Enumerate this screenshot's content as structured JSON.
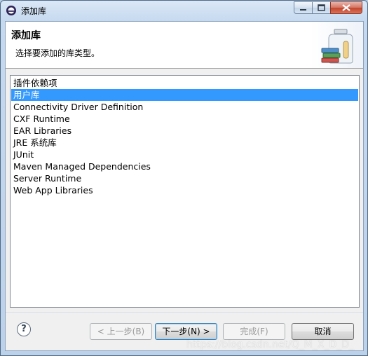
{
  "window": {
    "title": "添加库",
    "controls": {
      "minimize": "minimize",
      "maximize": "maximize",
      "close": "close"
    }
  },
  "header": {
    "title": "添加库",
    "description": "选择要添加的库类型。",
    "icon": "library-jar-icon"
  },
  "list": {
    "selected_index": 1,
    "items": [
      "插件依赖项",
      "用户库",
      "Connectivity Driver Definition",
      "CXF Runtime",
      "EAR Libraries",
      "JRE 系统库",
      "JUnit",
      "Maven Managed Dependencies",
      "Server Runtime",
      "Web App Libraries"
    ]
  },
  "buttons": {
    "back": "< 上一步(B)",
    "next": "下一步(N) >",
    "finish": "完成(F)",
    "cancel": "取消",
    "help": "?"
  },
  "watermark": "https://blog.csdn.net/Q_M_X_D_D_",
  "colors": {
    "selection": "#3399ff",
    "title_bar": "#c5d9ef",
    "close_button": "#c3452c"
  }
}
